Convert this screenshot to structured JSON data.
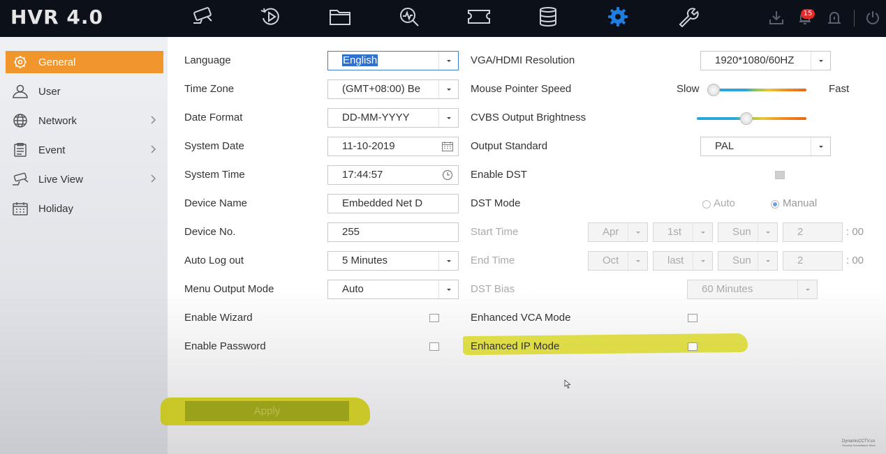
{
  "app": {
    "title": "HVR 4.0",
    "alarm_count": "15"
  },
  "topnav": [
    {
      "icon": "camera-icon"
    },
    {
      "icon": "playback-icon"
    },
    {
      "icon": "folder-icon"
    },
    {
      "icon": "search-icon"
    },
    {
      "icon": "video-card-icon"
    },
    {
      "icon": "storage-icon"
    },
    {
      "icon": "gear-icon",
      "active": true
    },
    {
      "icon": "wrench-icon"
    }
  ],
  "sidebar": {
    "items": [
      {
        "label": "General",
        "icon": "gear-icon",
        "active": true
      },
      {
        "label": "User",
        "icon": "user-icon"
      },
      {
        "label": "Network",
        "icon": "globe-icon"
      },
      {
        "label": "Event",
        "icon": "clipboard-icon"
      },
      {
        "label": "Live View",
        "icon": "camera-icon"
      },
      {
        "label": "Holiday",
        "icon": "calendar-icon"
      }
    ]
  },
  "left": {
    "language": {
      "label": "Language",
      "value": "English"
    },
    "time_zone": {
      "label": "Time Zone",
      "value": "(GMT+08:00) Be"
    },
    "date_format": {
      "label": "Date Format",
      "value": "DD-MM-YYYY"
    },
    "system_date": {
      "label": "System Date",
      "value": "11-10-2019"
    },
    "system_time": {
      "label": "System Time",
      "value": "17:44:57"
    },
    "device_name": {
      "label": "Device Name",
      "value": "Embedded Net D"
    },
    "device_no": {
      "label": "Device No.",
      "value": "255"
    },
    "auto_logout": {
      "label": "Auto Log out",
      "value": "5 Minutes"
    },
    "menu_output": {
      "label": "Menu Output Mode",
      "value": "Auto"
    },
    "enable_wizard": {
      "label": "Enable Wizard",
      "checked": false
    },
    "enable_password": {
      "label": "Enable Password",
      "checked": false
    }
  },
  "right": {
    "resolution": {
      "label": "VGA/HDMI Resolution",
      "value": "1920*1080/60HZ"
    },
    "mouse_speed": {
      "label": "Mouse Pointer Speed",
      "min_label": "Slow",
      "max_label": "Fast",
      "level": 0.0
    },
    "cvbs_brightness": {
      "label": "CVBS Output Brightness",
      "level": 0.45
    },
    "output_standard": {
      "label": "Output Standard",
      "value": "PAL"
    },
    "enable_dst": {
      "label": "Enable DST",
      "checked": true
    },
    "dst_mode": {
      "label": "DST Mode",
      "auto": "Auto",
      "manual": "Manual",
      "selected": "Manual"
    },
    "start_time": {
      "label": "Start Time",
      "month": "Apr",
      "week": "1st",
      "day": "Sun",
      "hour": "2",
      "minutes": ": 00"
    },
    "end_time": {
      "label": "End Time",
      "month": "Oct",
      "week": "last",
      "day": "Sun",
      "hour": "2",
      "minutes": ": 00"
    },
    "dst_bias": {
      "label": "DST Bias",
      "value": "60 Minutes"
    },
    "enhanced_vca": {
      "label": "Enhanced VCA Mode",
      "checked": false
    },
    "enhanced_ip": {
      "label": "Enhanced IP Mode",
      "checked": false
    }
  },
  "footer": {
    "apply_label": "Apply",
    "watermark_line1": "DynamicCCTV.co",
    "watermark_line2": "Security Surveillance Store"
  },
  "colors": {
    "accent": "#f0962c",
    "topbar": "#0c1018",
    "nav_active": "#1e7fe0",
    "highlight": "#d9d829"
  }
}
